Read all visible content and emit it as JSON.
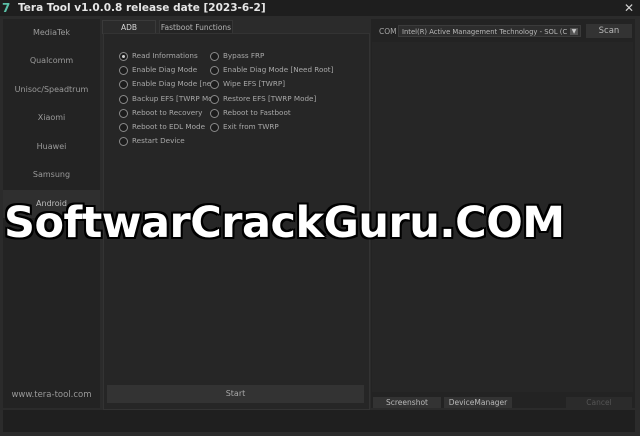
{
  "window": {
    "title": "Tera Tool v1.0.0.8 release date [2023-6-2]",
    "icon": "7",
    "close_glyph": "✕"
  },
  "sidebar": {
    "items": [
      {
        "label": "MediaTek"
      },
      {
        "label": "Qualcomm"
      },
      {
        "label": "Unisoc/Speadtrum"
      },
      {
        "label": "Xiaomi"
      },
      {
        "label": "Huawei"
      },
      {
        "label": "Samsung"
      },
      {
        "label": "Android"
      }
    ],
    "website": "www.tera-tool.com"
  },
  "tabs": [
    {
      "label": "ADB Functions"
    },
    {
      "label": "Fastboot Functions"
    }
  ],
  "options": {
    "left": [
      {
        "label": "Read Informations"
      },
      {
        "label": "Enable Diag Mode"
      },
      {
        "label": "Enable Diag Mode [new"
      },
      {
        "label": "Backup EFS [TWRP Mod"
      },
      {
        "label": "Reboot to Recovery"
      },
      {
        "label": "Reboot to EDL Mode"
      },
      {
        "label": "Restart Device"
      }
    ],
    "right": [
      {
        "label": "Bypass FRP"
      },
      {
        "label": "Enable Diag Mode [Need Root]"
      },
      {
        "label": "Wipe EFS [TWRP]"
      },
      {
        "label": "Restore EFS [TWRP Mode]"
      },
      {
        "label": "Reboot to Fastboot"
      },
      {
        "label": "Exit from TWRP"
      }
    ]
  },
  "start_button": "Start",
  "com": {
    "label": "COM",
    "selected": "Intel(R) Active Management Technology - SOL (C",
    "scan_button": "Scan"
  },
  "right_buttons": {
    "screenshot": "Screenshot",
    "device_manager": "DeviceManager",
    "cancel": "Cancel"
  },
  "watermark": "SoftwarCrackGuru.COM",
  "colors": {
    "background": "#2b2b2b",
    "panel": "#262626",
    "accent": "#5bc0a7"
  }
}
